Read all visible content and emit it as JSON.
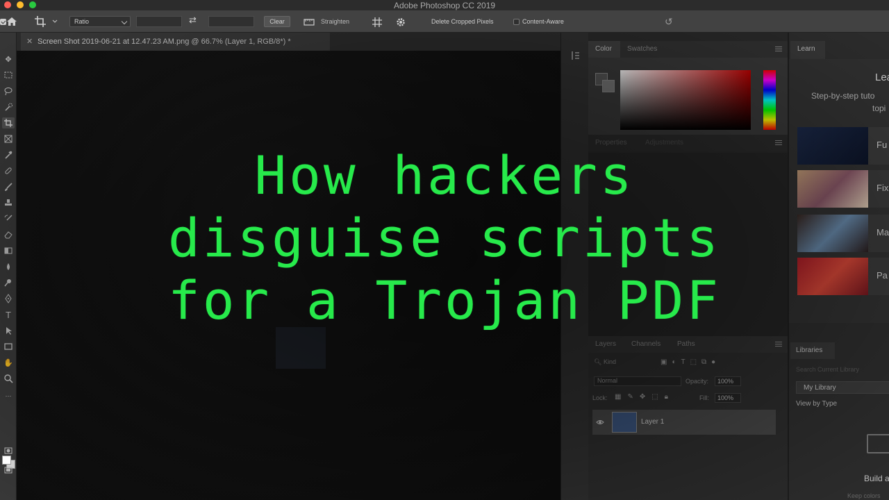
{
  "app": {
    "title": "Adobe Photoshop CC 2019"
  },
  "options_bar": {
    "ratio_label": "Ratio",
    "clear_label": "Clear",
    "straighten_label": "Straighten",
    "delete_cropped_label": "Delete Cropped Pixels",
    "delete_cropped_checked": true,
    "content_aware_label": "Content-Aware",
    "content_aware_checked": false
  },
  "document": {
    "tab_title": "Screen Shot 2019-06-21 at 12.47.23 AM.png @ 66.7% (Layer 1, RGB/8*) *"
  },
  "panels": {
    "color_tabs": [
      "Color",
      "Swatches"
    ],
    "properties_tabs": [
      "Properties",
      "Adjustments"
    ],
    "layers_tabs": [
      "Layers",
      "Channels",
      "Paths"
    ],
    "layers": {
      "filter_placeholder": "Kind",
      "blend_mode": "Normal",
      "opacity_label": "Opacity:",
      "opacity_value": "100%",
      "lock_label": "Lock:",
      "fill_label": "Fill:",
      "fill_value": "100%",
      "layer_name": "Layer 1"
    }
  },
  "learn": {
    "tab": "Learn",
    "heading": "Lea",
    "subtitle_1": "Step-by-step tuto",
    "subtitle_2": "topi",
    "tutorials": [
      "Fu",
      "Fix",
      "Ma",
      "Pa"
    ]
  },
  "libraries": {
    "tab": "Libraries",
    "search_placeholder": "Search Current Library",
    "selected_library": "My Library",
    "view_by": "View by Type",
    "build_text": "Build a C",
    "keep_text": "Keep colors"
  },
  "headline": {
    "line_1": "How hackers",
    "line_2": "disguise scripts",
    "line_3": "for a Trojan PDF",
    "color": "#27ea4b"
  }
}
